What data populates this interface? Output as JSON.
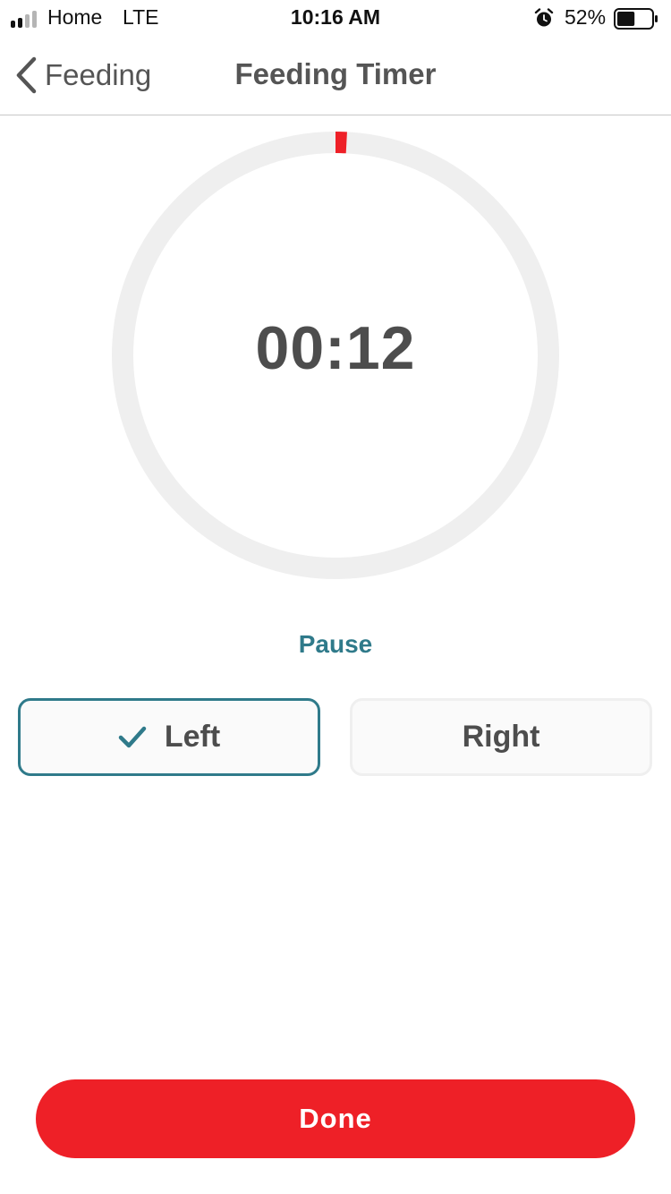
{
  "status_bar": {
    "carrier": "Home",
    "network": "LTE",
    "time": "10:16 AM",
    "battery_percent": "52%",
    "battery_level": 0.52,
    "signal_bars_active": 2,
    "signal_bars_total": 4,
    "icons": [
      "signal-icon",
      "alarm-icon",
      "battery-icon"
    ]
  },
  "nav": {
    "back_label": "Feeding",
    "title": "Feeding Timer",
    "back_icon": "chevron-left-icon"
  },
  "timer": {
    "value": "00:12",
    "progress_fraction": 0.0083
  },
  "controls": {
    "pause_label": "Pause",
    "sides": [
      {
        "label": "Left",
        "selected": true,
        "icon": "check-icon"
      },
      {
        "label": "Right",
        "selected": false
      }
    ],
    "done_label": "Done"
  },
  "colors": {
    "accent_teal": "#2f7a8a",
    "brand_red": "#ee2027",
    "ring_track": "#efefef",
    "progress_red": "#ee2027"
  }
}
